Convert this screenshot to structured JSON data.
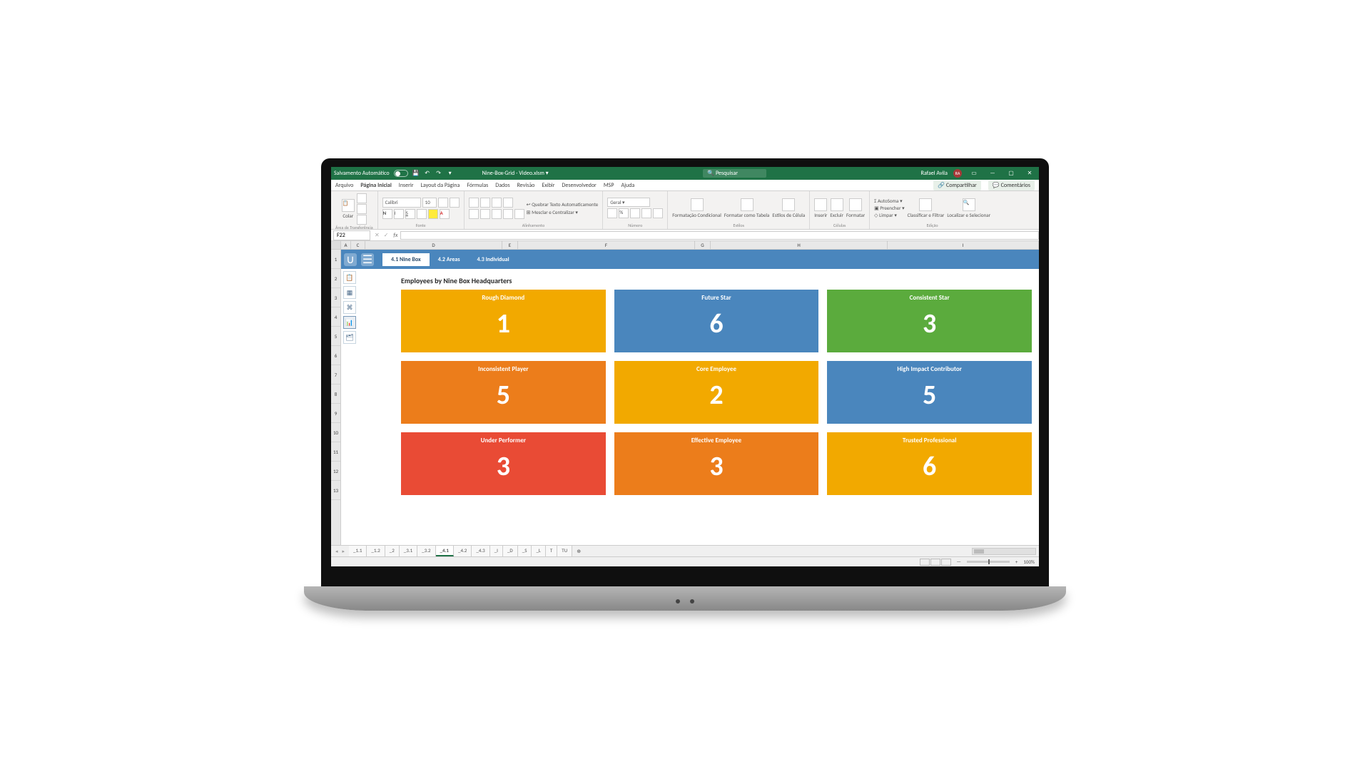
{
  "titlebar": {
    "autosave": "Salvamento Automático",
    "filename": "Nine-Box-Grid - Video.xlsm ▾",
    "search_placeholder": "Pesquisar",
    "user": "Rafael Avila",
    "user_initials": "RA"
  },
  "menu": {
    "items": [
      "Arquivo",
      "Página Inicial",
      "Inserir",
      "Layout da Página",
      "Fórmulas",
      "Dados",
      "Revisão",
      "Exibir",
      "Desenvolvedor",
      "MSP",
      "Ajuda"
    ],
    "share": "Compartilhar",
    "comments": "Comentários"
  },
  "ribbon": {
    "clipboard": "Área de Transferência",
    "paste": "Colar",
    "font": "Fonte",
    "font_name": "Calibri",
    "font_size": "10",
    "alignment": "Alinhamento",
    "wrap": "Quebrar Texto Automaticamente",
    "merge": "Mesclar e Centralizar",
    "number": "Número",
    "number_format": "Geral",
    "styles": "Estilos",
    "cond_format": "Formatação Condicional",
    "format_table": "Formatar como Tabela",
    "cell_styles": "Estilos de Célula",
    "cells": "Células",
    "insert": "Inserir",
    "delete": "Excluir",
    "format": "Formatar",
    "editing": "Edição",
    "autosum": "AutoSoma",
    "fill": "Preencher",
    "clear": "Limpar",
    "sort": "Classificar e Filtrar",
    "find": "Localizar e Selecionar"
  },
  "formula": {
    "cell_ref": "F22",
    "fx": "fx"
  },
  "columns": [
    "A",
    "C",
    "D",
    "E",
    "F",
    "G",
    "H",
    "I"
  ],
  "rows": [
    "1",
    "2",
    "3",
    "4",
    "5",
    "6",
    "7",
    "8",
    "9",
    "10",
    "11",
    "12",
    "13"
  ],
  "dashboard": {
    "tabs": [
      "4.1 Nine Box",
      "4.2 Areas",
      "4.3 Individual"
    ],
    "title": "Employees by Nine Box Headquarters",
    "boxes": [
      {
        "label": "Rough Diamond",
        "value": "1",
        "color": "#f2a900"
      },
      {
        "label": "Future Star",
        "value": "6",
        "color": "#4a86bd"
      },
      {
        "label": "Consistent Star",
        "value": "3",
        "color": "#5bab3d"
      },
      {
        "label": "Inconsistent Player",
        "value": "5",
        "color": "#ec7d1b"
      },
      {
        "label": "Core Employee",
        "value": "2",
        "color": "#f2a900"
      },
      {
        "label": "High Impact Contributor",
        "value": "5",
        "color": "#4a86bd"
      },
      {
        "label": "Under Performer",
        "value": "3",
        "color": "#e94b35"
      },
      {
        "label": "Effective Employee",
        "value": "3",
        "color": "#ec7d1b"
      },
      {
        "label": "Trusted Professional",
        "value": "6",
        "color": "#f2a900"
      }
    ]
  },
  "sheets": [
    "_1.1",
    "_1.2",
    "_2",
    "_3.1",
    "_3.2",
    "_4.1",
    "_4.2",
    "_4.3",
    "_I",
    "_D",
    "_S",
    "_L",
    "T",
    "TU"
  ],
  "sheet_active_index": 5,
  "status": {
    "zoom": "100%"
  }
}
